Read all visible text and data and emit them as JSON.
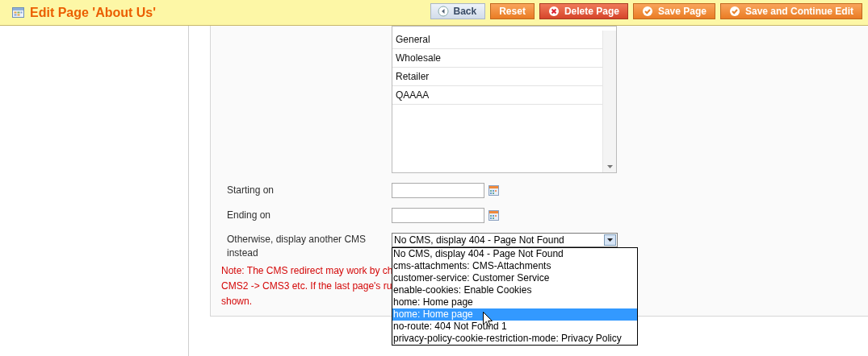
{
  "header": {
    "title": "Edit Page 'About Us'",
    "buttons": [
      {
        "label": "Back",
        "kind": "back"
      },
      {
        "label": "Reset",
        "kind": "reset"
      },
      {
        "label": "Delete Page",
        "kind": "delete"
      },
      {
        "label": "Save Page",
        "kind": "save"
      },
      {
        "label": "Save and Continue Edit",
        "kind": "save"
      }
    ]
  },
  "form": {
    "groups": {
      "items": [
        {
          "label": "General",
          "selected": false
        },
        {
          "label": "Wholesale",
          "selected": false
        },
        {
          "label": "Retailer",
          "selected": false
        },
        {
          "label": "QAAAA",
          "selected": false
        }
      ]
    },
    "dates": [
      {
        "label": "Starting on"
      },
      {
        "label": "Ending on"
      }
    ],
    "redirect": {
      "label": "Otherwise, display another CMS instead",
      "value": "No CMS, display 404 - Page Not Found",
      "options": [
        {
          "label": "No CMS, display 404 - Page Not Found",
          "highlighted": false
        },
        {
          "label": "cms-attachments: CMS-Attachments",
          "highlighted": false
        },
        {
          "label": "customer-service: Customer Service",
          "highlighted": false
        },
        {
          "label": "enable-cookies: Enable Cookies",
          "highlighted": false
        },
        {
          "label": "home: Home page",
          "highlighted": false
        },
        {
          "label": "home: Home page",
          "highlighted": true
        },
        {
          "label": "no-route: 404 Not Found 1",
          "highlighted": false
        },
        {
          "label": "privacy-policy-cookie-restriction-mode: Privacy Policy",
          "highlighted": false
        }
      ]
    },
    "note_lines": [
      "Note: The CMS redirect may work by ch",
      "CMS2 -> CMS3 etc. If the last page's ru",
      "shown."
    ]
  }
}
